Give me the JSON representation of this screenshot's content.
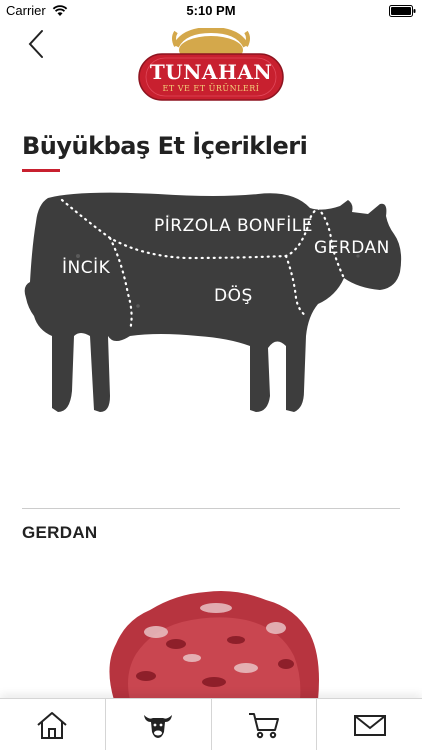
{
  "status_bar": {
    "carrier": "Carrier",
    "time": "5:10 PM",
    "wifi_icon": "wifi-icon",
    "battery_icon": "battery-icon"
  },
  "header": {
    "back_icon": "chevron-left-icon",
    "logo": {
      "name": "TUNAHAN",
      "subtitle": "ET VE ET ÜRÜNLERİ",
      "colors": {
        "badge": "#c8202f",
        "ring": "#d4a84b"
      }
    }
  },
  "page": {
    "title": "Büyükbaş Et İçerikleri",
    "accent_color": "#c8202f"
  },
  "cow_diagram": {
    "body_color": "#3d3d3d",
    "labels": {
      "pirzola": "PİRZOLA BONFİLE",
      "gerdan": "GERDAN",
      "incik": "İNCİK",
      "dos": "DÖŞ"
    }
  },
  "section": {
    "title": "GERDAN"
  },
  "tab_bar": {
    "tabs": [
      {
        "name": "home",
        "icon": "home-icon"
      },
      {
        "name": "products",
        "icon": "cow-icon"
      },
      {
        "name": "cart",
        "icon": "cart-icon"
      },
      {
        "name": "contact",
        "icon": "mail-icon"
      }
    ]
  }
}
